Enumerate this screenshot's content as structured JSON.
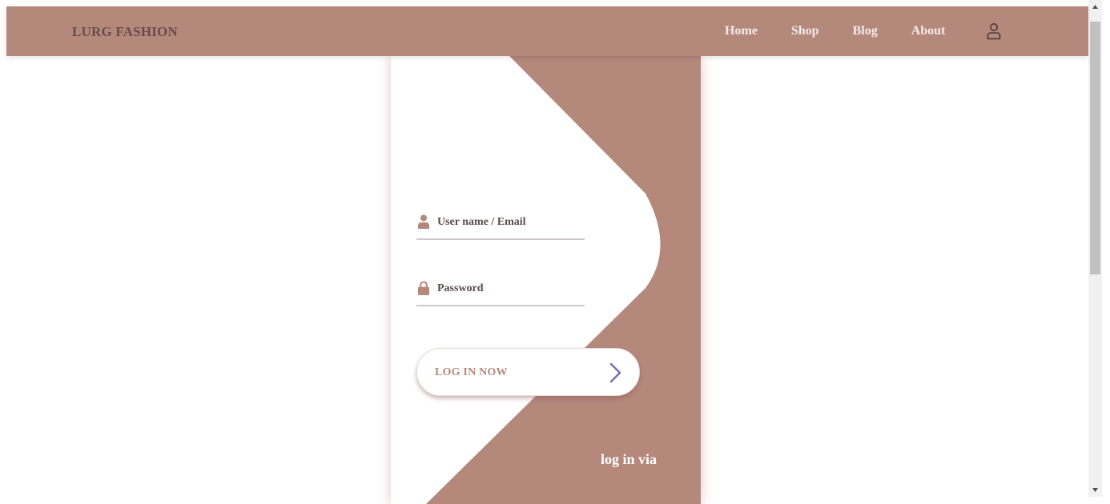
{
  "navbar": {
    "brand": "LURG FASHION",
    "links": [
      {
        "label": "Home"
      },
      {
        "label": "Shop"
      },
      {
        "label": "Blog"
      },
      {
        "label": "About"
      }
    ],
    "account_icon": "user-outline-icon"
  },
  "login": {
    "username_placeholder": "User name / Email",
    "username_icon": "user-icon",
    "password_placeholder": "Password",
    "password_icon": "lock-icon",
    "button_label": "LOG IN NOW",
    "button_icon": "chevron-right-icon",
    "social_label": "log in via"
  },
  "colors": {
    "brand": "#b5887c",
    "brand_dark_text": "#6b4b49",
    "nav_text": "#f4ebe9",
    "arrow": "#6f6fb0"
  }
}
